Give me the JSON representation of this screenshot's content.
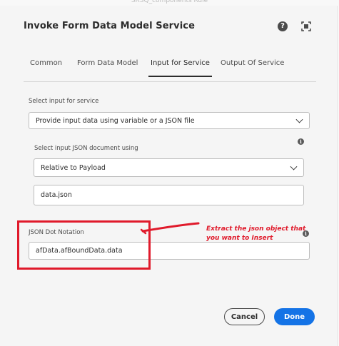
{
  "top_strip_text": "SRSQ_components Rule",
  "dialog": {
    "title": "Invoke Form Data Model Service",
    "help_icon": "help-icon",
    "fullscreen_icon": "fullscreen-icon"
  },
  "tabs": [
    {
      "label": "Common",
      "active": false
    },
    {
      "label": "Form Data Model",
      "active": false
    },
    {
      "label": "Input for Service",
      "active": true
    },
    {
      "label": "Output Of Service",
      "active": false
    }
  ],
  "form": {
    "select_input_label": "Select input for service",
    "select_input_value": "Provide input data using variable or a JSON file",
    "json_doc_label": "Select input JSON document using",
    "json_doc_value": "Relative to Payload",
    "json_file_value": "data.json",
    "dot_notation_label": "JSON Dot Notation",
    "dot_notation_value": "afData.afBoundData.data"
  },
  "annotation": {
    "text": "Extract the json object that you want to Insert",
    "color": "#e01a2b"
  },
  "buttons": {
    "cancel": "Cancel",
    "done": "Done"
  },
  "colors": {
    "accent": "#1473e6",
    "annotation_red": "#e01a2b"
  }
}
